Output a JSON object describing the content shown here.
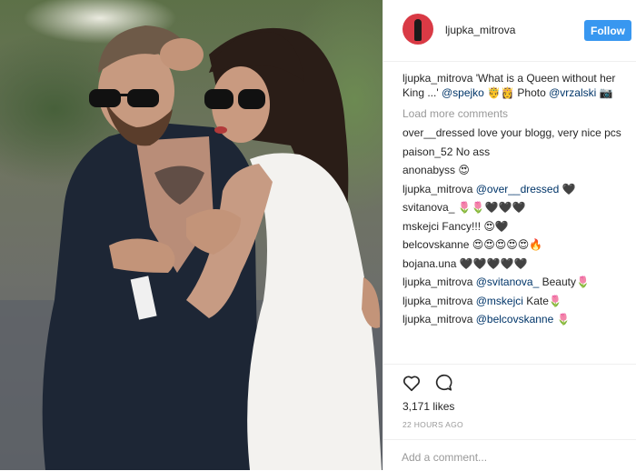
{
  "post": {
    "author": "ljupka_mitrova",
    "follow_label": "Follow",
    "caption": {
      "user": "ljupka_mitrova",
      "text": " 'What is a Queen without her King ...' ",
      "mention1": "@spejko",
      "text2": " 🤴👸 Photo ",
      "mention2": "@vrzalski",
      "text3": " 📷"
    },
    "load_more": "Load more comments",
    "comments": [
      {
        "user": "over__dressed",
        "text": " love your blogg, very nice pcs"
      },
      {
        "user": "paison_52",
        "text": " No ass"
      },
      {
        "user": "anonabyss",
        "text": " 😍"
      },
      {
        "user": "ljupka_mitrova",
        "mention": "@over__dressed",
        "text": " 🖤"
      },
      {
        "user": "svitanova_",
        "text": " 🌷🌷🖤🖤🖤"
      },
      {
        "user": "mskejci",
        "text": " Fancy!!! 😍🖤"
      },
      {
        "user": "belcovskanne",
        "text": " 😍😍😍😍😍🔥"
      },
      {
        "user": "bojana.una",
        "text": " 🖤🖤🖤🖤🖤"
      },
      {
        "user": "ljupka_mitrova",
        "mention": "@svitanova_",
        "text": " Beauty🌷"
      },
      {
        "user": "ljupka_mitrova",
        "mention": "@mskejci",
        "text": " Kate🌷"
      },
      {
        "user": "ljupka_mitrova",
        "mention": "@belcovskanne",
        "text": " 🌷"
      }
    ],
    "likes": "3,171 likes",
    "time": "22 HOURS AGO",
    "add_comment_placeholder": "Add a comment..."
  },
  "colors": {
    "follow_bg": "#3897f0",
    "mention": "#003569",
    "muted": "#999999",
    "avatar_bg": "#d93a45"
  },
  "icons": {
    "like": "heart-outline-icon",
    "comment": "speech-bubble-icon"
  }
}
